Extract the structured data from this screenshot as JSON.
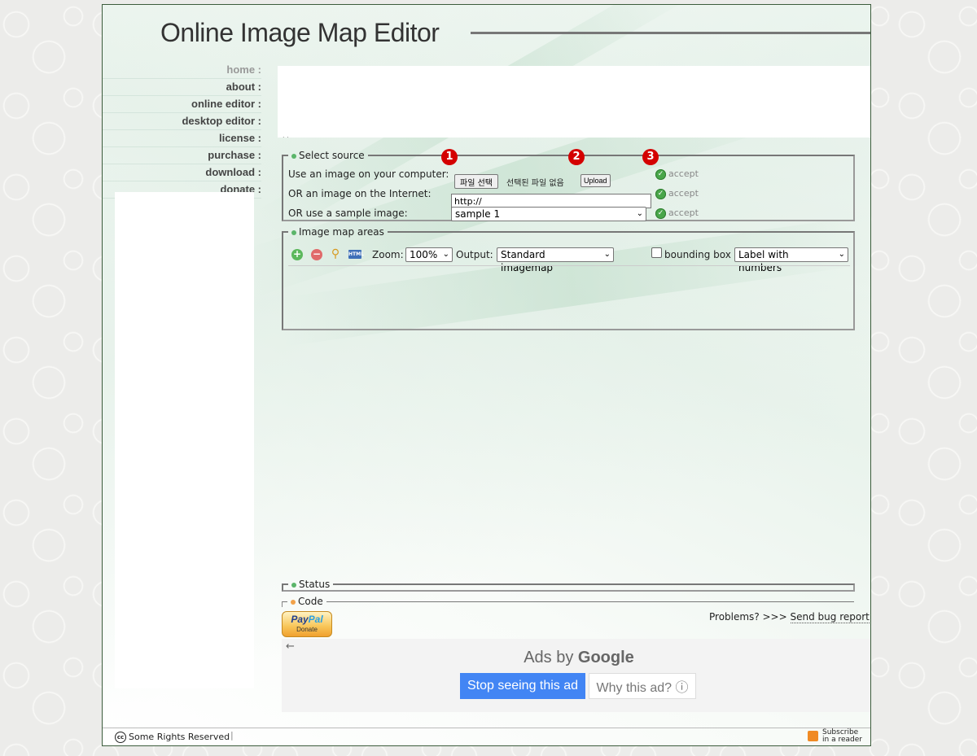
{
  "header": {
    "title": "Online Image Map Editor"
  },
  "nav": {
    "items": [
      {
        "label": "home :"
      },
      {
        "label": "about :"
      },
      {
        "label": "online editor :"
      },
      {
        "label": "desktop editor :"
      },
      {
        "label": "license :"
      },
      {
        "label": "purchase :"
      },
      {
        "label": "download :"
      },
      {
        "label": "donate :"
      }
    ]
  },
  "top_ad": {
    "text": ". ."
  },
  "select_source": {
    "legend": "Select source",
    "computer_label": "Use an image on your computer:",
    "file_button": "파일 선택",
    "file_status": "선택된 파일 없음",
    "upload_button": "Upload",
    "internet_label": "OR an image on the Internet:",
    "url_value": "http://",
    "sample_label": "OR use a sample image:",
    "sample_selected": "sample 1",
    "accept_label": "accept",
    "step_badges": [
      "1",
      "2",
      "3"
    ]
  },
  "image_map_areas": {
    "legend": "Image map areas",
    "tools": [
      "add-icon",
      "remove-icon",
      "zoom-icon",
      "html-icon"
    ],
    "zoom_label": "Zoom:",
    "zoom_selected": "100%",
    "output_label": "Output:",
    "output_selected": "Standard imagemap",
    "bounding_box_label": "bounding box",
    "label_mode_selected": "Label with numbers"
  },
  "status": {
    "legend": "Status"
  },
  "code": {
    "legend": "Code"
  },
  "paypal": {
    "brand_pay": "Pay",
    "brand_pal": "Pal",
    "donate": "Donate"
  },
  "problems": {
    "prefix": "Problems? >>>",
    "link": "Send bug report"
  },
  "ads": {
    "back_arrow": "←",
    "ads_by": "Ads by",
    "google": "Google",
    "stop_button": "Stop seeing this ad",
    "why_button": "Why this ad? ⓘ"
  },
  "footer": {
    "cc_icon": "cc",
    "rights": "Some Rights Reserved",
    "separator": "|",
    "subscribe_line1": "Subscribe",
    "subscribe_line2": "in a reader"
  },
  "colors": {
    "accent_green": "#5bb56a",
    "badge_red": "#d40000",
    "ads_blue": "#4285f4"
  }
}
